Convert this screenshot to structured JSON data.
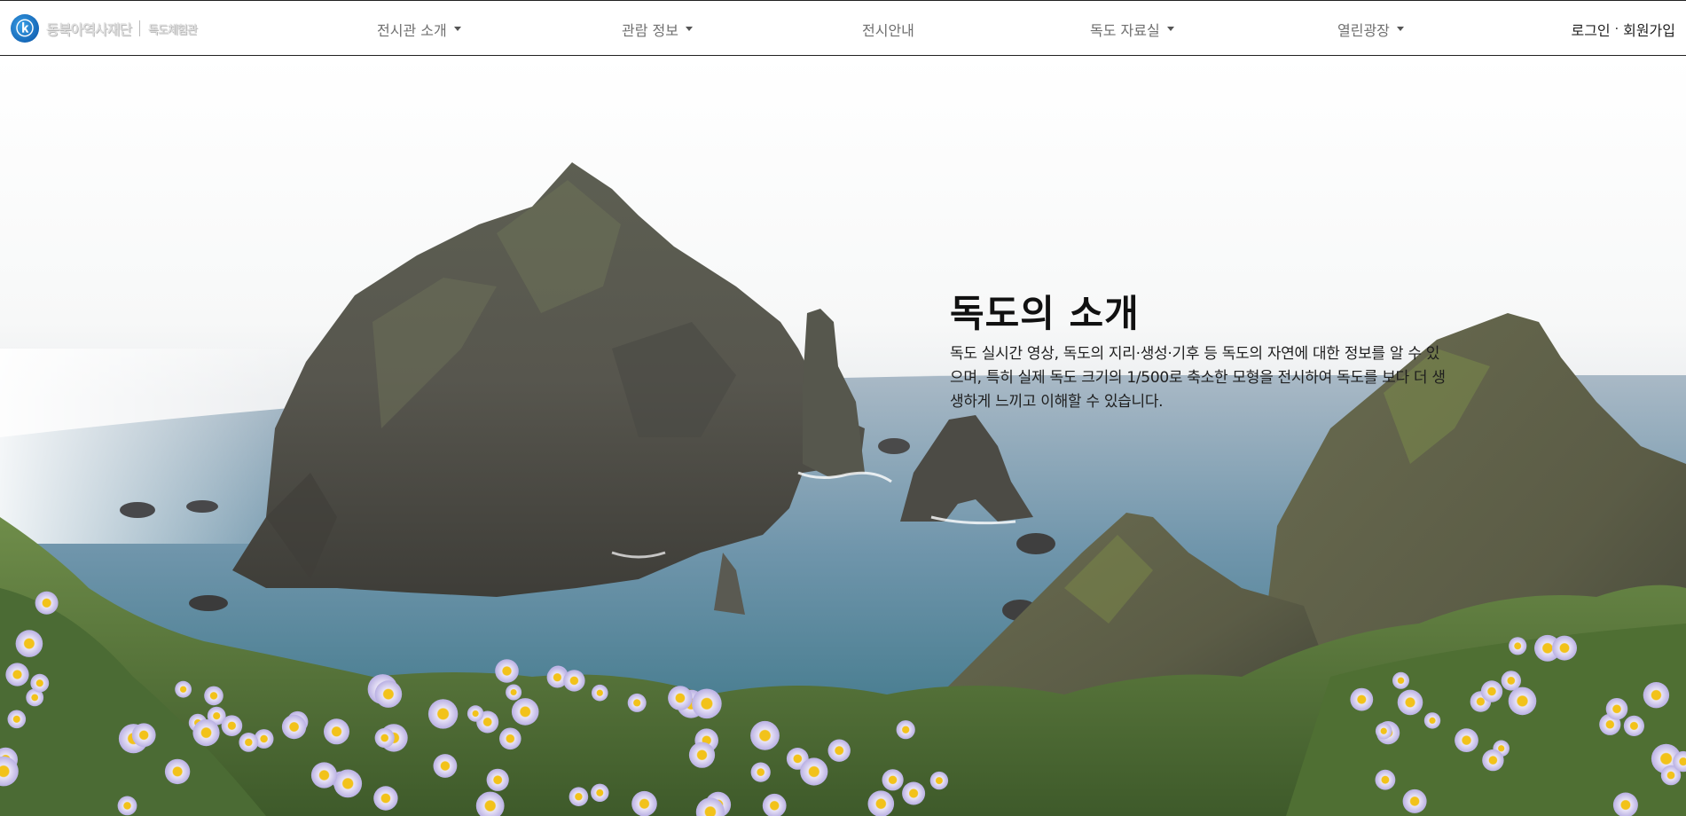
{
  "header": {
    "logo_icon": "museum-emblem-icon",
    "logo_text": "동북아역사재단",
    "logo_subtext": "독도체험관",
    "nav": [
      {
        "label": "전시관 소개",
        "has_dropdown": true
      },
      {
        "label": "관람 정보",
        "has_dropdown": true
      },
      {
        "label": "전시안내",
        "has_dropdown": false
      },
      {
        "label": "독도 자료실",
        "has_dropdown": true
      },
      {
        "label": "열린광장",
        "has_dropdown": true
      }
    ],
    "auth": {
      "login": "로그인",
      "separator": "·",
      "signup": "회원가입"
    }
  },
  "hero": {
    "title": "독도의 소개",
    "description": "독도 실시간 영상, 독도의 지리·생성·기후 등 독도의 자연에 대한 정보를 알 수 있으며, 특히 실제 독도 크기의 1/500로 축소한 모형을 전시하여 독도를 보다 더 생생하게 느끼고 이해할 수 있습니다.",
    "image": "dokdo-island-landscape-photo"
  },
  "colors": {
    "accent_blue": "#1668b8",
    "sea": "#3f7d8f",
    "rock": "#5b5a52",
    "flower": "#d8d2f0",
    "flower_center": "#f2c21a"
  }
}
